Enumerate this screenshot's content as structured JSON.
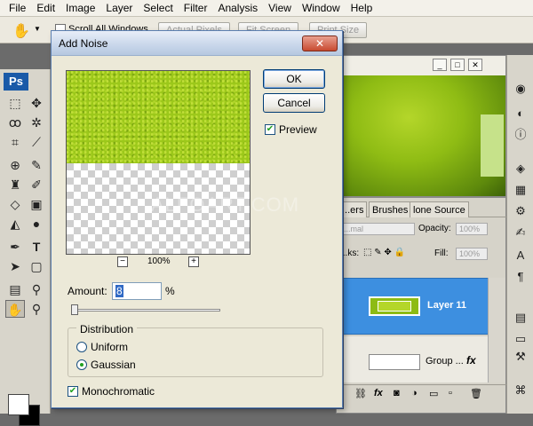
{
  "menu": [
    "File",
    "Edit",
    "Image",
    "Layer",
    "Select",
    "Filter",
    "Analysis",
    "View",
    "Window",
    "Help"
  ],
  "options_bar": {
    "scroll_all_windows": "Scroll All Windows",
    "actual_pixels": "Actual Pixels",
    "fit_screen": "Fit Screen",
    "print_size": "Print Size"
  },
  "toolbox": {
    "logo": "Ps"
  },
  "dialog": {
    "title": "Add Noise",
    "close": "✕",
    "ok": "OK",
    "cancel": "Cancel",
    "preview_label": "Preview",
    "preview_checked": true,
    "zoom_minus": "−",
    "zoom_plus": "+",
    "zoom_level": "100%",
    "amount_label": "Amount:",
    "amount_value": "8",
    "amount_unit": "%",
    "distribution_label": "Distribution",
    "uniform_label": "Uniform",
    "gaussian_label": "Gaussian",
    "distribution_selected": "Gaussian",
    "monochromatic_label": "Monochromatic",
    "monochromatic_checked": true
  },
  "layers_panel": {
    "tabs": [
      "...ers",
      "Brushes",
      "lone Source"
    ],
    "blend_mode": "...mal",
    "opacity_label": "Opacity:",
    "opacity_value": "100%",
    "lock_label": "...ks:",
    "fill_label": "Fill:",
    "fill_value": "100%",
    "layers": [
      {
        "name": "Layer 11",
        "selected": true
      },
      {
        "name": "Group ...",
        "fx": "fx"
      }
    ]
  },
  "watermark": "ALFOART.COM",
  "colors": {
    "selection_blue": "#3d8fe0",
    "canvas_green": "#8fbc14",
    "dialog_bg": "#ece9d8"
  }
}
